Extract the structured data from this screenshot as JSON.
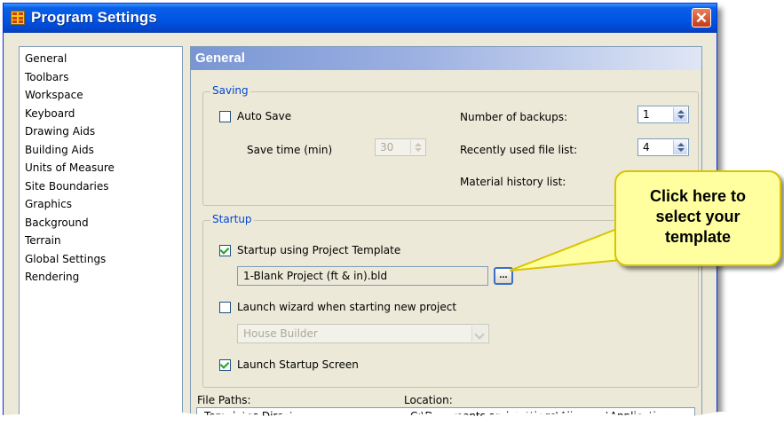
{
  "window": {
    "title": "Program Settings",
    "close_glyph": "✕"
  },
  "sidebar": {
    "items": [
      {
        "label": "General"
      },
      {
        "label": "Toolbars"
      },
      {
        "label": "Workspace"
      },
      {
        "label": "Keyboard"
      },
      {
        "label": "Drawing Aids"
      },
      {
        "label": "Building Aids"
      },
      {
        "label": "Units of Measure"
      },
      {
        "label": "Site Boundaries"
      },
      {
        "label": "Graphics"
      },
      {
        "label": "Background"
      },
      {
        "label": "Terrain"
      },
      {
        "label": "Global Settings"
      },
      {
        "label": "Rendering"
      }
    ]
  },
  "panel": {
    "title": "General",
    "saving": {
      "legend": "Saving",
      "auto_save_label": "Auto Save",
      "save_time_label": "Save time (min)",
      "save_time_value": "30",
      "backups_label": "Number of backups:",
      "backups_value": "1",
      "recent_label": "Recently used file list:",
      "recent_value": "4",
      "material_label": "Material history list:"
    },
    "startup": {
      "legend": "Startup",
      "template_checkbox_label": "Startup using Project Template",
      "template_value": "1-Blank Project (ft & in).bld",
      "browse_glyph": "...",
      "wizard_label": "Launch wizard when starting new project",
      "wizard_select_value": "House Builder",
      "startup_screen_label": "Launch Startup Screen"
    },
    "paths": {
      "file_paths_label": "File Paths:",
      "location_label": "Location:",
      "row_name": "Templates Directory",
      "row_location": "C:\\Documents and Settings\\All Users\\Application"
    }
  },
  "callout": {
    "text_line1": "Click here to",
    "text_line2": "select your",
    "text_line3": "template"
  }
}
